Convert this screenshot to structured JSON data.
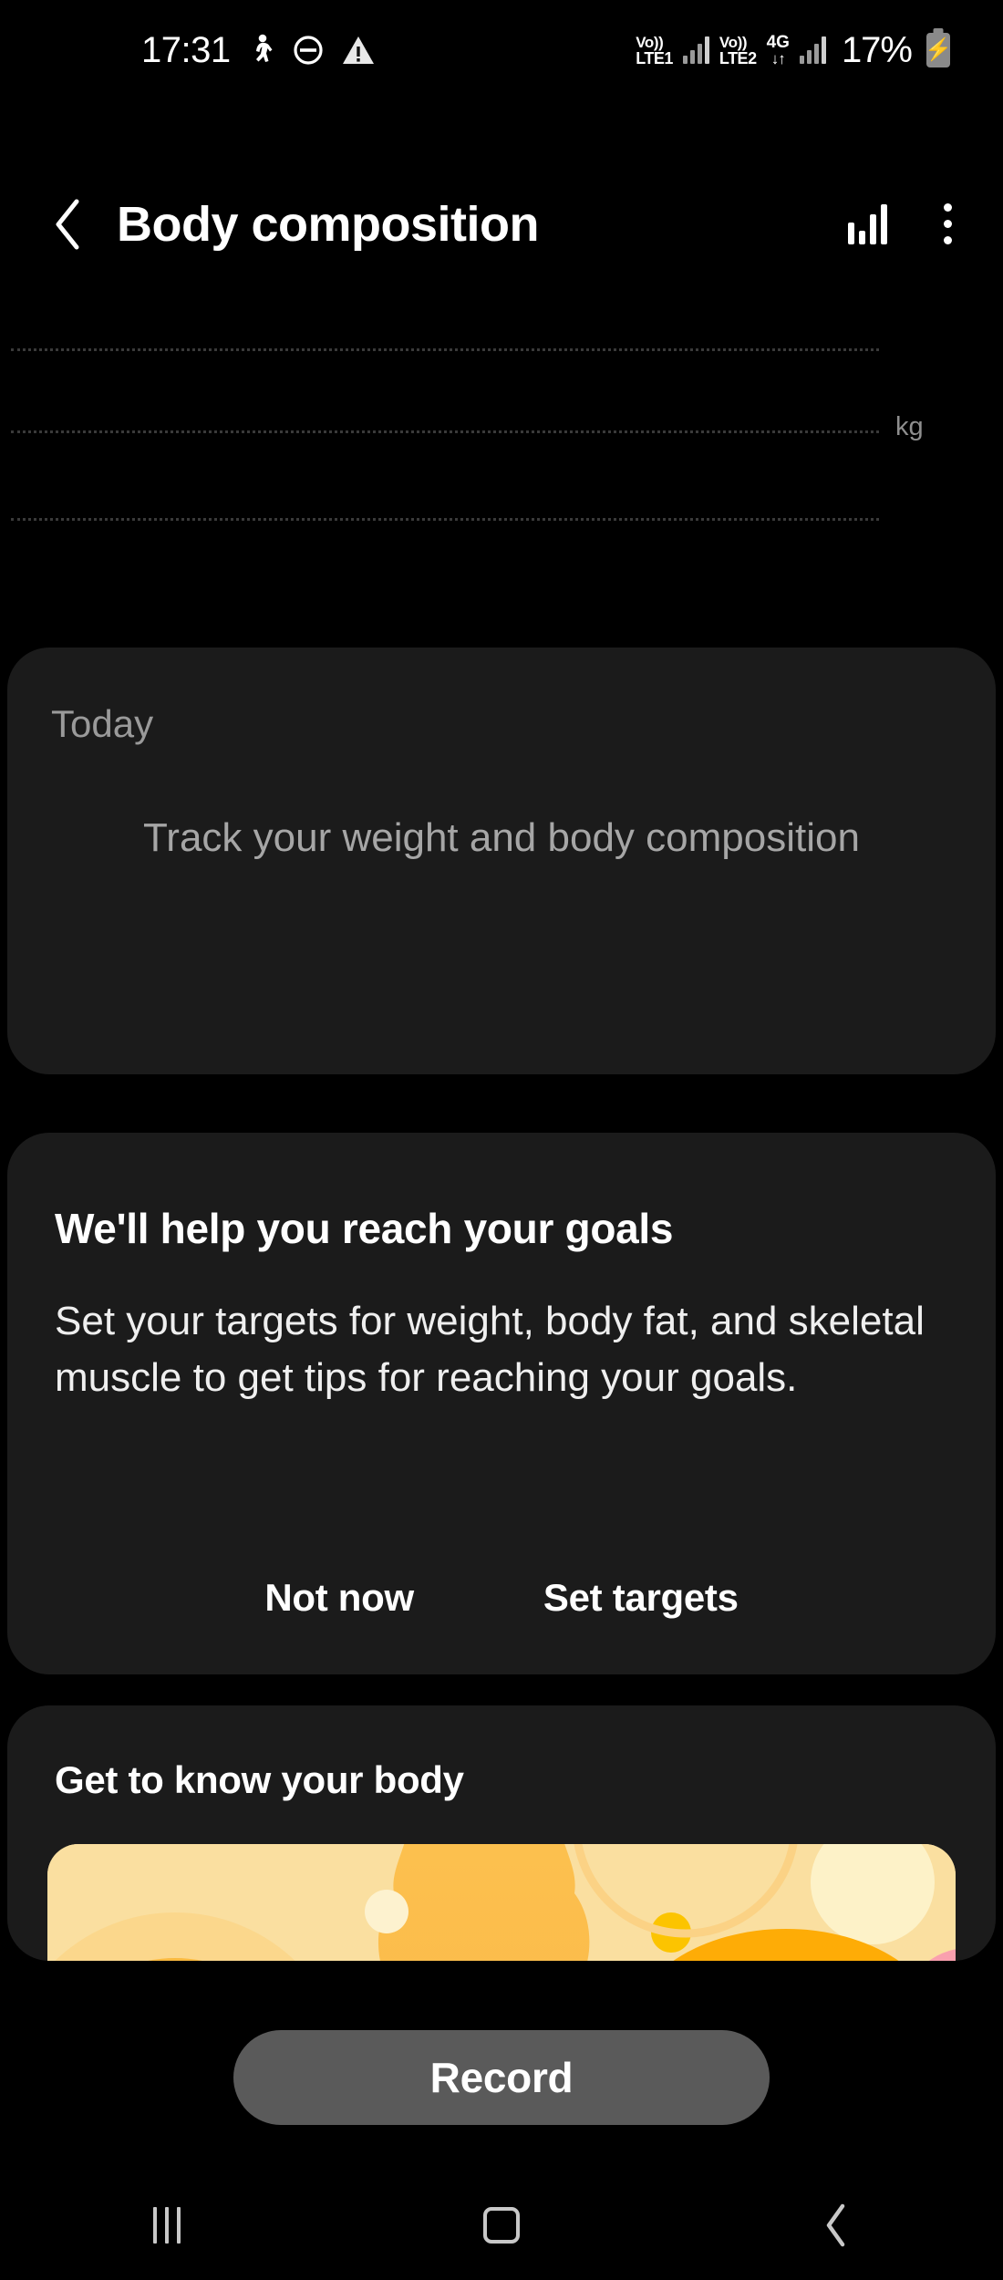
{
  "status_bar": {
    "time": "17:31",
    "left_icons": [
      "pedestrian-icon",
      "do-not-disturb-icon",
      "warning-icon"
    ],
    "sim1_label_top": "Vo))",
    "sim1_label_bottom": "LTE1",
    "sim2_label_top": "Vo))",
    "sim2_label_bottom": "LTE2",
    "network_type": "4G",
    "data_arrows": "↓↑",
    "battery_percent": "17%",
    "battery_state": "charging"
  },
  "app_bar": {
    "back_icon": "chevron-left-icon",
    "title": "Body composition",
    "chart_icon": "bar-chart-icon",
    "more_icon": "overflow-menu-icon"
  },
  "chart": {
    "unit_label": "kg",
    "gridline_count": 3
  },
  "chart_data": {
    "type": "line",
    "title": "Body composition",
    "ylabel": "kg",
    "x": [],
    "values": [],
    "gridlines": 3,
    "grid": true,
    "note": "Empty chart — no data points recorded",
    "legend": []
  },
  "today_card": {
    "label": "Today",
    "empty_message": "Track your weight and body composition"
  },
  "goals_card": {
    "title": "We'll help you reach your goals",
    "body": "Set your targets for weight, body fat, and skeletal muscle to get tips for reaching your goals.",
    "dismiss_label": "Not now",
    "confirm_label": "Set targets"
  },
  "know_card": {
    "title": "Get to know your body",
    "banner_alt": "body-composition-illustration"
  },
  "record_button": {
    "label": "Record"
  },
  "nav_bar": {
    "recents_icon": "recent-apps-icon",
    "home_icon": "home-icon",
    "back_icon": "back-icon"
  },
  "colors": {
    "background": "#000000",
    "card": "#1b1b1b",
    "record_button": "#5a5a5a",
    "primary_text": "#ffffff",
    "secondary_text": "#9a9a9a",
    "banner_base": "#fadfa0",
    "banner_accent": "#ffad2b",
    "banner_deep": "#f5642f"
  }
}
